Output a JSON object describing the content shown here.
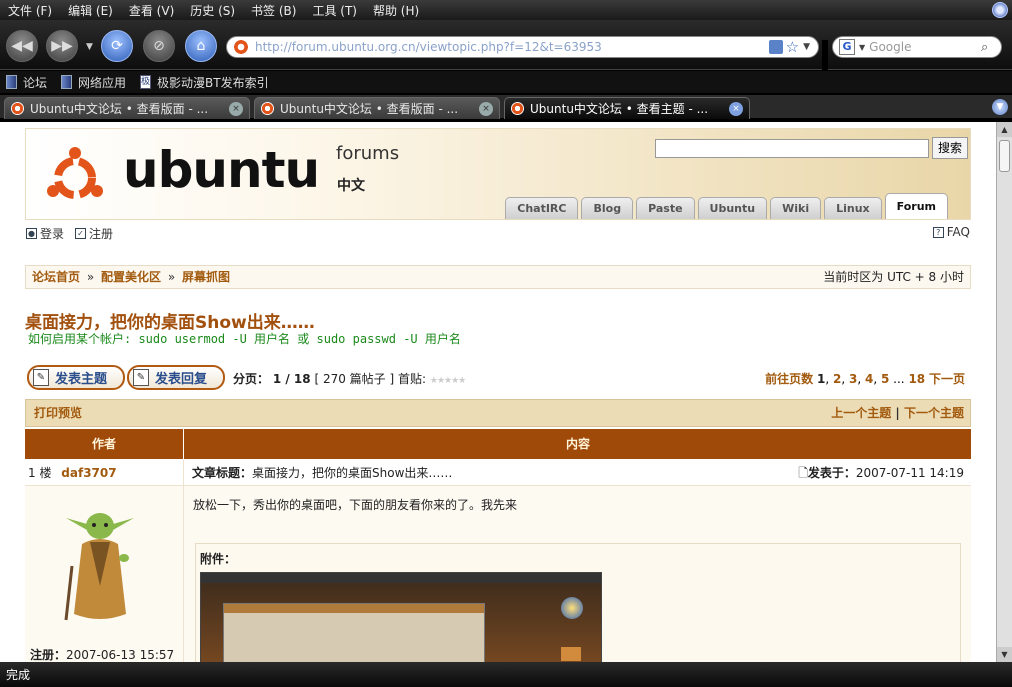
{
  "menu": {
    "items": [
      "文件 (F)",
      "编辑 (E)",
      "查看 (V)",
      "历史 (S)",
      "书签 (B)",
      "工具 (T)",
      "帮助 (H)"
    ]
  },
  "nav": {
    "url": "http://forum.ubuntu.org.cn/viewtopic.php?f=12&t=63953",
    "search_placeholder": "Google"
  },
  "bookmarks": [
    {
      "label": "论坛"
    },
    {
      "label": "网络应用"
    },
    {
      "label": "极影动漫BT发布索引"
    }
  ],
  "tabs": [
    {
      "title": "Ubuntu中文论坛 • 查看版面 - ..."
    },
    {
      "title": "Ubuntu中文论坛 • 查看版面 - ..."
    },
    {
      "title": "Ubuntu中文论坛 • 查看主题 - ..."
    }
  ],
  "header": {
    "logo": "ubuntu",
    "forums": "forums",
    "zh": "中文",
    "search_button": "搜索",
    "nav_tabs": [
      "ChatIRC",
      "Blog",
      "Paste",
      "Ubuntu",
      "Wiki",
      "Linux",
      "Forum"
    ]
  },
  "login": {
    "login": "登录",
    "register": "注册",
    "faq": "FAQ"
  },
  "breadcrumb": {
    "items": [
      "论坛首页",
      "配置美化区",
      "屏幕抓图"
    ],
    "sep": "»",
    "timezone": "当前时区为 UTC + 8 小时"
  },
  "topic": {
    "title": "桌面接力，把你的桌面Show出来……",
    "desc": "如何启用某个帐户: sudo usermod -U 用户名 或 sudo passwd -U 用户名"
  },
  "actions": {
    "new_topic": "发表主题",
    "reply": "发表回复",
    "page_label": "分页：",
    "page_info": "1 / 18",
    "posts": "[ 270 篇帖子 ]",
    "first_post": "首贴:",
    "goto": "前往页数",
    "pages": [
      "1",
      "2",
      "3",
      "4",
      "5",
      "...",
      "18"
    ],
    "next": "下一页"
  },
  "printbar": {
    "print": "打印预览",
    "prev": "上一个主题",
    "sep": "|",
    "next": "下一个主题"
  },
  "table": {
    "author_col": "作者",
    "content_col": "内容"
  },
  "post": {
    "floor": "1 楼",
    "author": "daf3707",
    "subject_label": "文章标题：",
    "subject": "桌面接力，把你的桌面Show出来……",
    "posted_label": "发表于：",
    "posted": "2007-07-11 14:19",
    "message": "放松一下，秀出你的桌面吧，下面的朋友看你来的了。我先来",
    "attach_label": "附件：",
    "reg_label": "注册：",
    "reg_date": "2007-06-13 15:57"
  },
  "status": {
    "text": "完成"
  }
}
